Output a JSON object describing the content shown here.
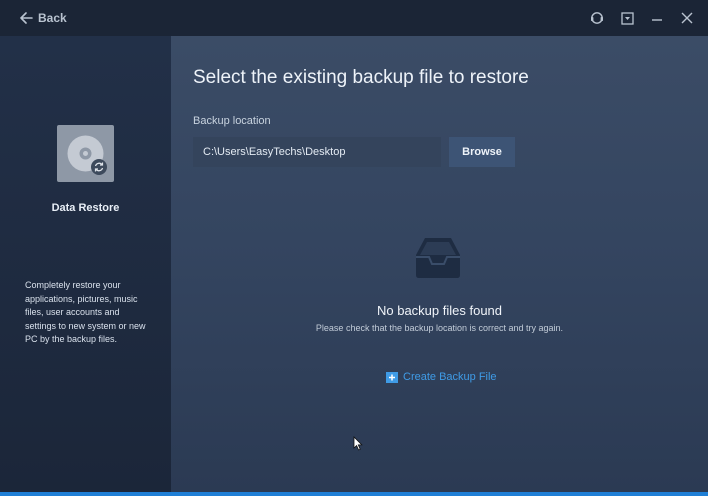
{
  "titlebar": {
    "back_label": "Back",
    "controls": [
      "help-icon",
      "settings-icon",
      "minimize-icon",
      "close-icon"
    ]
  },
  "sidebar": {
    "icon": "hard-disk-restore-icon",
    "title": "Data Restore",
    "description": "Completely restore your applications, pictures, music files, user accounts and settings to new system or new PC by the backup files."
  },
  "main": {
    "title": "Select the existing backup file to restore",
    "location_label": "Backup location",
    "location_value": "C:\\Users\\EasyTechs\\Desktop",
    "browse_label": "Browse",
    "empty_icon": "empty-tray-icon",
    "empty_title": "No backup files found",
    "empty_hint": "Please check that the backup location is correct and try again.",
    "create_label": "Create Backup File"
  },
  "colors": {
    "background": "#1a2434",
    "sidebar": "#223048",
    "main": "#3b4c66",
    "accent": "#3f9be6",
    "button": "#3d5475"
  }
}
